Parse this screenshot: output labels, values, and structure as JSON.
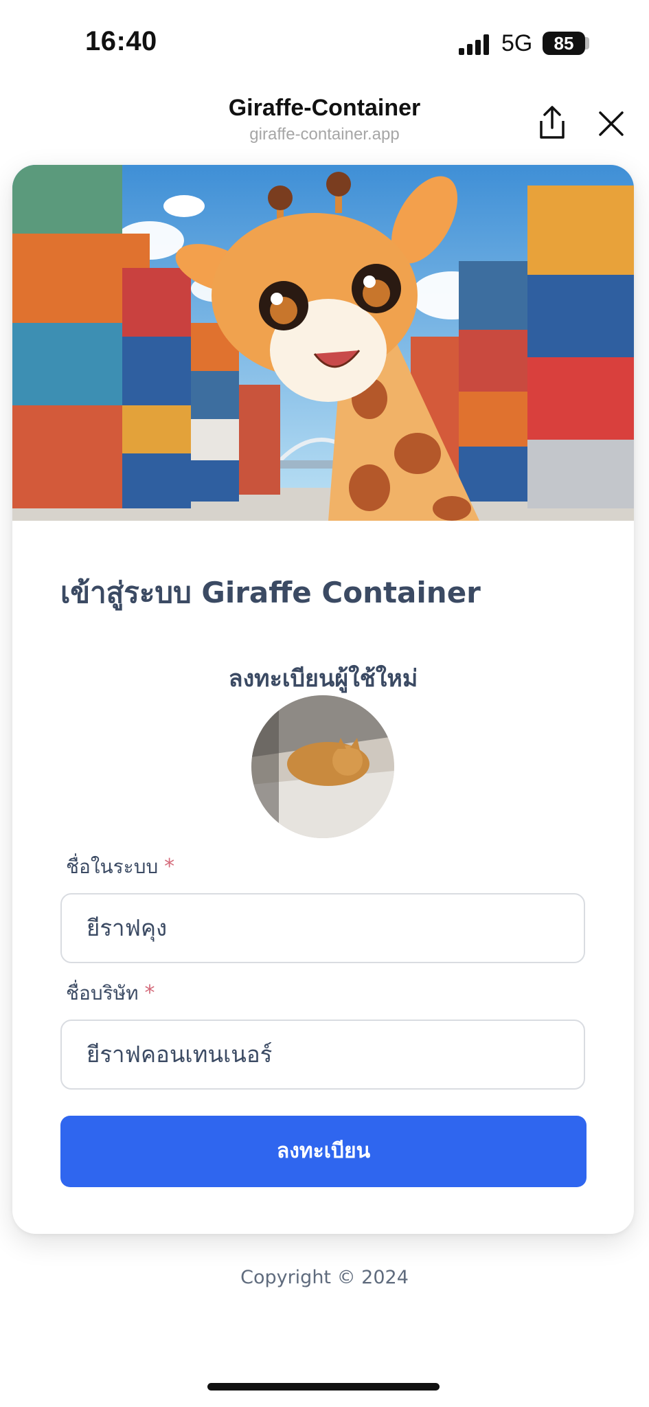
{
  "status_bar": {
    "time": "16:40",
    "network": "5G",
    "battery": "85"
  },
  "browser": {
    "title": "Giraffe-Container",
    "url": "giraffe-container.app"
  },
  "page": {
    "login_title": "เข้าสู่ระบบ Giraffe Container",
    "register_heading": "ลงทะเบียนผู้ใช้ใหม่",
    "username_label": "ชื่อในระบบ",
    "username_value": "ยีราฟคุง",
    "company_label": "ชื่อบริษัท",
    "company_value": "ยีราฟคอนเทนเนอร์",
    "required_mark": "*",
    "submit_label": "ลงทะเบียน"
  },
  "footer": {
    "copyright": "Copyright © 2024"
  },
  "colors": {
    "accent": "#2f66ef",
    "text": "#3b4a63",
    "required": "#d46a7a"
  }
}
